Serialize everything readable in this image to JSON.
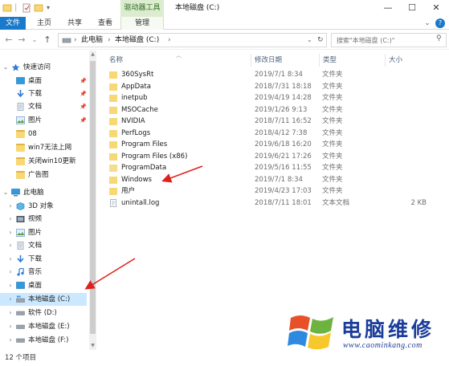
{
  "window": {
    "title": "本地磁盘 (C:)",
    "context_tab_group": "驱动器工具",
    "controls": [
      "—",
      "☐",
      "✕"
    ]
  },
  "ribbon": {
    "tabs": [
      "文件",
      "主页",
      "共享",
      "查看",
      "管理"
    ],
    "help": "?"
  },
  "address": {
    "segments": [
      "此电脑",
      "本地磁盘 (C:)"
    ],
    "search_placeholder": "搜索\"本地磁盘 (C:)\""
  },
  "nav": {
    "quick_access": "快速访问",
    "pinned": [
      "桌面",
      "下载",
      "文档",
      "图片"
    ],
    "recent": [
      "08",
      "win7无法上网",
      "关闭win10更新",
      "广告图"
    ],
    "this_pc": "此电脑",
    "pc_items": [
      "3D 对象",
      "视频",
      "图片",
      "文档",
      "下载",
      "音乐",
      "桌面"
    ],
    "drives": [
      "本地磁盘 (C:)",
      "软件 (D:)",
      "本地磁盘 (E:)",
      "本地磁盘 (F:)"
    ],
    "selected": "本地磁盘 (C:)"
  },
  "columns": {
    "name": "名称",
    "date": "修改日期",
    "type": "类型",
    "size": "大小"
  },
  "files": [
    {
      "name": "360SysRt",
      "date": "2019/7/1 8:34",
      "type": "文件夹",
      "size": ""
    },
    {
      "name": "AppData",
      "date": "2018/7/31 18:18",
      "type": "文件夹",
      "size": ""
    },
    {
      "name": "inetpub",
      "date": "2019/4/19 14:28",
      "type": "文件夹",
      "size": ""
    },
    {
      "name": "MSOCache",
      "date": "2019/1/26 9:13",
      "type": "文件夹",
      "size": ""
    },
    {
      "name": "NVIDIA",
      "date": "2018/7/11 16:52",
      "type": "文件夹",
      "size": ""
    },
    {
      "name": "PerfLogs",
      "date": "2018/4/12 7:38",
      "type": "文件夹",
      "size": ""
    },
    {
      "name": "Program Files",
      "date": "2019/6/18 16:20",
      "type": "文件夹",
      "size": ""
    },
    {
      "name": "Program Files (x86)",
      "date": "2019/6/21 17:26",
      "type": "文件夹",
      "size": ""
    },
    {
      "name": "ProgramData",
      "date": "2019/5/16 11:55",
      "type": "文件夹",
      "size": ""
    },
    {
      "name": "Windows",
      "date": "2019/7/1 8:34",
      "type": "文件夹",
      "size": ""
    },
    {
      "name": "用户",
      "date": "2019/4/23 17:03",
      "type": "文件夹",
      "size": ""
    },
    {
      "name": "unintall.log",
      "date": "2018/7/11 18:01",
      "type": "文本文档",
      "size": "2 KB"
    }
  ],
  "status": {
    "item_count": "12 个项目"
  },
  "watermark": {
    "brand": "电脑维修",
    "url": "www.caominkang.com"
  },
  "colors": {
    "accent": "#1979ca",
    "selection": "#cce8ff",
    "context_tab": "#dbeccf",
    "arrow": "#e0201b",
    "watermark": "#1b3d9a"
  }
}
